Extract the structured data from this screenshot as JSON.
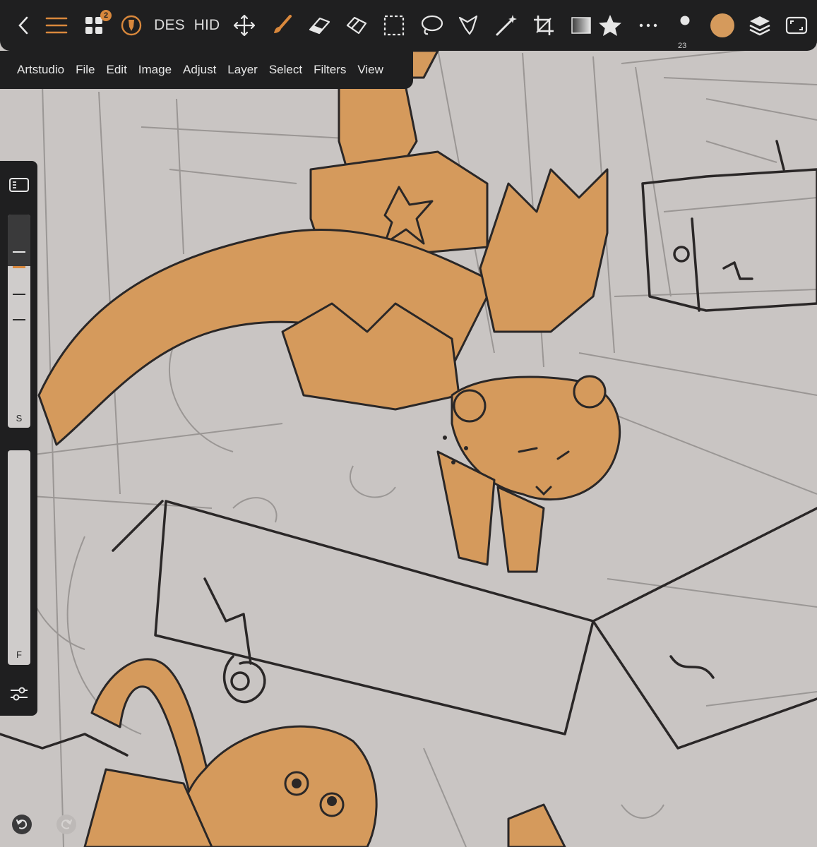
{
  "toolbar": {
    "layers_badge": "2",
    "des_label": "DES",
    "hid_label": "HID",
    "brush_size": "23",
    "current_color": "#d59a5c"
  },
  "menu": {
    "items": [
      "Artstudio",
      "File",
      "Edit",
      "Image",
      "Adjust",
      "Layer",
      "Select",
      "Filters",
      "View"
    ]
  },
  "left_panel": {
    "size_slider_label": "S",
    "flow_slider_label": "F"
  },
  "colors": {
    "toolbar_bg": "#1f1f20",
    "accent": "#d9883c",
    "paint": "#d59a5c",
    "canvas_bg": "#c9c5c3"
  }
}
